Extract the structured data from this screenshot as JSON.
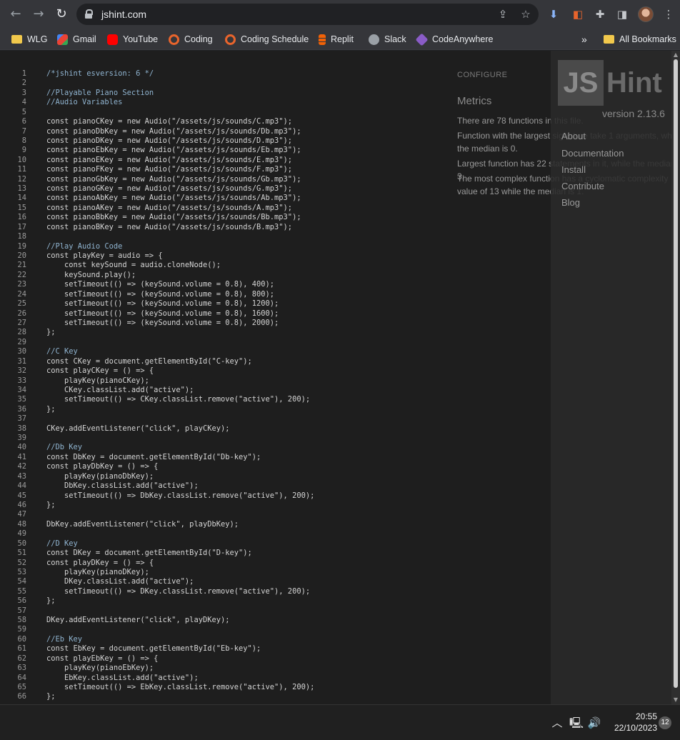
{
  "browser": {
    "url": "jshint.com",
    "icons": [
      "arrow-back-icon",
      "arrow-forward-icon",
      "reload-icon",
      "lock-icon",
      "share-icon",
      "star-icon",
      "download-icon",
      "extension-icon",
      "puzzle-icon",
      "sidepanel-icon",
      "avatar",
      "more-icon"
    ]
  },
  "bookmarks": [
    {
      "label": "WLG",
      "icon": "folder",
      "color": "#f2c94c"
    },
    {
      "label": "Gmail",
      "icon": "gmail",
      "color": "#ea4335"
    },
    {
      "label": "YouTube",
      "icon": "youtube",
      "color": "#ff0000"
    },
    {
      "label": "Coding",
      "icon": "circle",
      "color": "#e8642c"
    },
    {
      "label": "Coding Schedule",
      "icon": "circle",
      "color": "#e8642c"
    },
    {
      "label": "Replit",
      "icon": "replit",
      "color": "#f26207"
    },
    {
      "label": "Slack",
      "icon": "globe",
      "color": "#9aa0a6"
    },
    {
      "label": "CodeAnywhere",
      "icon": "cube",
      "color": "#8a5cc7"
    }
  ],
  "bookmarks_more": "»",
  "all_bookmarks": "All Bookmarks",
  "code": [
    {
      "n": "1",
      "t": "/*jshint esversion: 6 */",
      "c": true
    },
    {
      "n": "2",
      "t": ""
    },
    {
      "n": "3",
      "t": "//Playable Piano Section",
      "c": true
    },
    {
      "n": "4",
      "t": "//Audio Variables",
      "c": true
    },
    {
      "n": "5",
      "t": ""
    },
    {
      "n": "6",
      "t": "const pianoCKey = new Audio(\"/assets/js/sounds/C.mp3\");"
    },
    {
      "n": "7",
      "t": "const pianoDbKey = new Audio(\"/assets/js/sounds/Db.mp3\");"
    },
    {
      "n": "8",
      "t": "const pianoDKey = new Audio(\"/assets/js/sounds/D.mp3\");"
    },
    {
      "n": "9",
      "t": "const pianoEbKey = new Audio(\"/assets/js/sounds/Eb.mp3\");"
    },
    {
      "n": "10",
      "t": "const pianoEKey = new Audio(\"/assets/js/sounds/E.mp3\");"
    },
    {
      "n": "11",
      "t": "const pianoFKey = new Audio(\"/assets/js/sounds/F.mp3\");"
    },
    {
      "n": "12",
      "t": "const pianoGbKey = new Audio(\"/assets/js/sounds/Gb.mp3\");"
    },
    {
      "n": "13",
      "t": "const pianoGKey = new Audio(\"/assets/js/sounds/G.mp3\");"
    },
    {
      "n": "14",
      "t": "const pianoAbKey = new Audio(\"/assets/js/sounds/Ab.mp3\");"
    },
    {
      "n": "15",
      "t": "const pianoAKey = new Audio(\"/assets/js/sounds/A.mp3\");"
    },
    {
      "n": "16",
      "t": "const pianoBbKey = new Audio(\"/assets/js/sounds/Bb.mp3\");"
    },
    {
      "n": "17",
      "t": "const pianoBKey = new Audio(\"/assets/js/sounds/B.mp3\");"
    },
    {
      "n": "18",
      "t": ""
    },
    {
      "n": "19",
      "t": "//Play Audio Code",
      "c": true
    },
    {
      "n": "20",
      "t": "const playKey = audio => {"
    },
    {
      "n": "21",
      "t": "    const keySound = audio.cloneNode();"
    },
    {
      "n": "22",
      "t": "    keySound.play();"
    },
    {
      "n": "23",
      "t": "    setTimeout(() => (keySound.volume = 0.8), 400);"
    },
    {
      "n": "24",
      "t": "    setTimeout(() => (keySound.volume = 0.8), 800);"
    },
    {
      "n": "25",
      "t": "    setTimeout(() => (keySound.volume = 0.8), 1200);"
    },
    {
      "n": "26",
      "t": "    setTimeout(() => (keySound.volume = 0.8), 1600);"
    },
    {
      "n": "27",
      "t": "    setTimeout(() => (keySound.volume = 0.8), 2000);"
    },
    {
      "n": "28",
      "t": "};"
    },
    {
      "n": "29",
      "t": ""
    },
    {
      "n": "30",
      "t": "//C Key",
      "c": true
    },
    {
      "n": "31",
      "t": "const CKey = document.getElementById(\"C-key\");"
    },
    {
      "n": "32",
      "t": "const playCKey = () => {"
    },
    {
      "n": "33",
      "t": "    playKey(pianoCKey);"
    },
    {
      "n": "34",
      "t": "    CKey.classList.add(\"active\");"
    },
    {
      "n": "35",
      "t": "    setTimeout(() => CKey.classList.remove(\"active\"), 200);"
    },
    {
      "n": "36",
      "t": "};"
    },
    {
      "n": "37",
      "t": ""
    },
    {
      "n": "38",
      "t": "CKey.addEventListener(\"click\", playCKey);"
    },
    {
      "n": "39",
      "t": ""
    },
    {
      "n": "40",
      "t": "//Db Key",
      "c": true
    },
    {
      "n": "41",
      "t": "const DbKey = document.getElementById(\"Db-key\");"
    },
    {
      "n": "42",
      "t": "const playDbKey = () => {"
    },
    {
      "n": "43",
      "t": "    playKey(pianoDbKey);"
    },
    {
      "n": "44",
      "t": "    DbKey.classList.add(\"active\");"
    },
    {
      "n": "45",
      "t": "    setTimeout(() => DbKey.classList.remove(\"active\"), 200);"
    },
    {
      "n": "46",
      "t": "};"
    },
    {
      "n": "47",
      "t": ""
    },
    {
      "n": "48",
      "t": "DbKey.addEventListener(\"click\", playDbKey);"
    },
    {
      "n": "49",
      "t": ""
    },
    {
      "n": "50",
      "t": "//D Key",
      "c": true
    },
    {
      "n": "51",
      "t": "const DKey = document.getElementById(\"D-key\");"
    },
    {
      "n": "52",
      "t": "const playDKey = () => {"
    },
    {
      "n": "53",
      "t": "    playKey(pianoDKey);"
    },
    {
      "n": "54",
      "t": "    DKey.classList.add(\"active\");"
    },
    {
      "n": "55",
      "t": "    setTimeout(() => DKey.classList.remove(\"active\"), 200);"
    },
    {
      "n": "56",
      "t": "};"
    },
    {
      "n": "57",
      "t": ""
    },
    {
      "n": "58",
      "t": "DKey.addEventListener(\"click\", playDKey);"
    },
    {
      "n": "59",
      "t": ""
    },
    {
      "n": "60",
      "t": "//Eb Key",
      "c": true
    },
    {
      "n": "61",
      "t": "const EbKey = document.getElementById(\"Eb-key\");"
    },
    {
      "n": "62",
      "t": "const playEbKey = () => {"
    },
    {
      "n": "63",
      "t": "    playKey(pianoEbKey);"
    },
    {
      "n": "64",
      "t": "    EbKey.classList.add(\"active\");"
    },
    {
      "n": "65",
      "t": "    setTimeout(() => EbKey.classList.remove(\"active\"), 200);"
    },
    {
      "n": "66",
      "t": "};"
    }
  ],
  "configure": "CONFIGURE",
  "metrics": {
    "title": "Metrics",
    "lines": [
      "There are 78 functions in this file.",
      "Function with the largest signature take 1 arguments, while the median is 0.",
      "Largest function has 22 statements in it, while the median is 3.",
      "The most complex function has a cyclomatic complexity value of 13 while the median is 1."
    ]
  },
  "sidebar": {
    "logo_js": "JS",
    "logo_hint": "Hint",
    "version": "version 2.13.6",
    "links": [
      "About",
      "Documentation",
      "Install",
      "Contribute",
      "Blog"
    ]
  },
  "taskbar": {
    "time": "20:55",
    "date": "22/10/2023",
    "notifications": "12"
  }
}
